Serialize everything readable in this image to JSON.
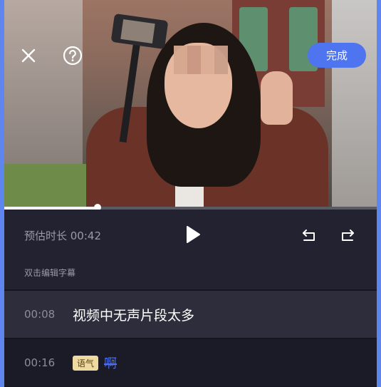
{
  "toolbar": {
    "done_label": "完成"
  },
  "player": {
    "progress_fraction": 0.25,
    "duration_label": "预估时长 00:42"
  },
  "hint": "双击编辑字幕",
  "subtitles": [
    {
      "time": "00:08",
      "text": "视频中无声片段太多"
    },
    {
      "time": "00:16",
      "tag": "语气",
      "removed_text": "啊"
    }
  ],
  "colors": {
    "accent": "#4e74f0",
    "background": "#151520",
    "tag_bg": "#eed9a0"
  },
  "icons": [
    "close-icon",
    "help-icon",
    "play-icon",
    "undo-icon",
    "redo-icon"
  ]
}
